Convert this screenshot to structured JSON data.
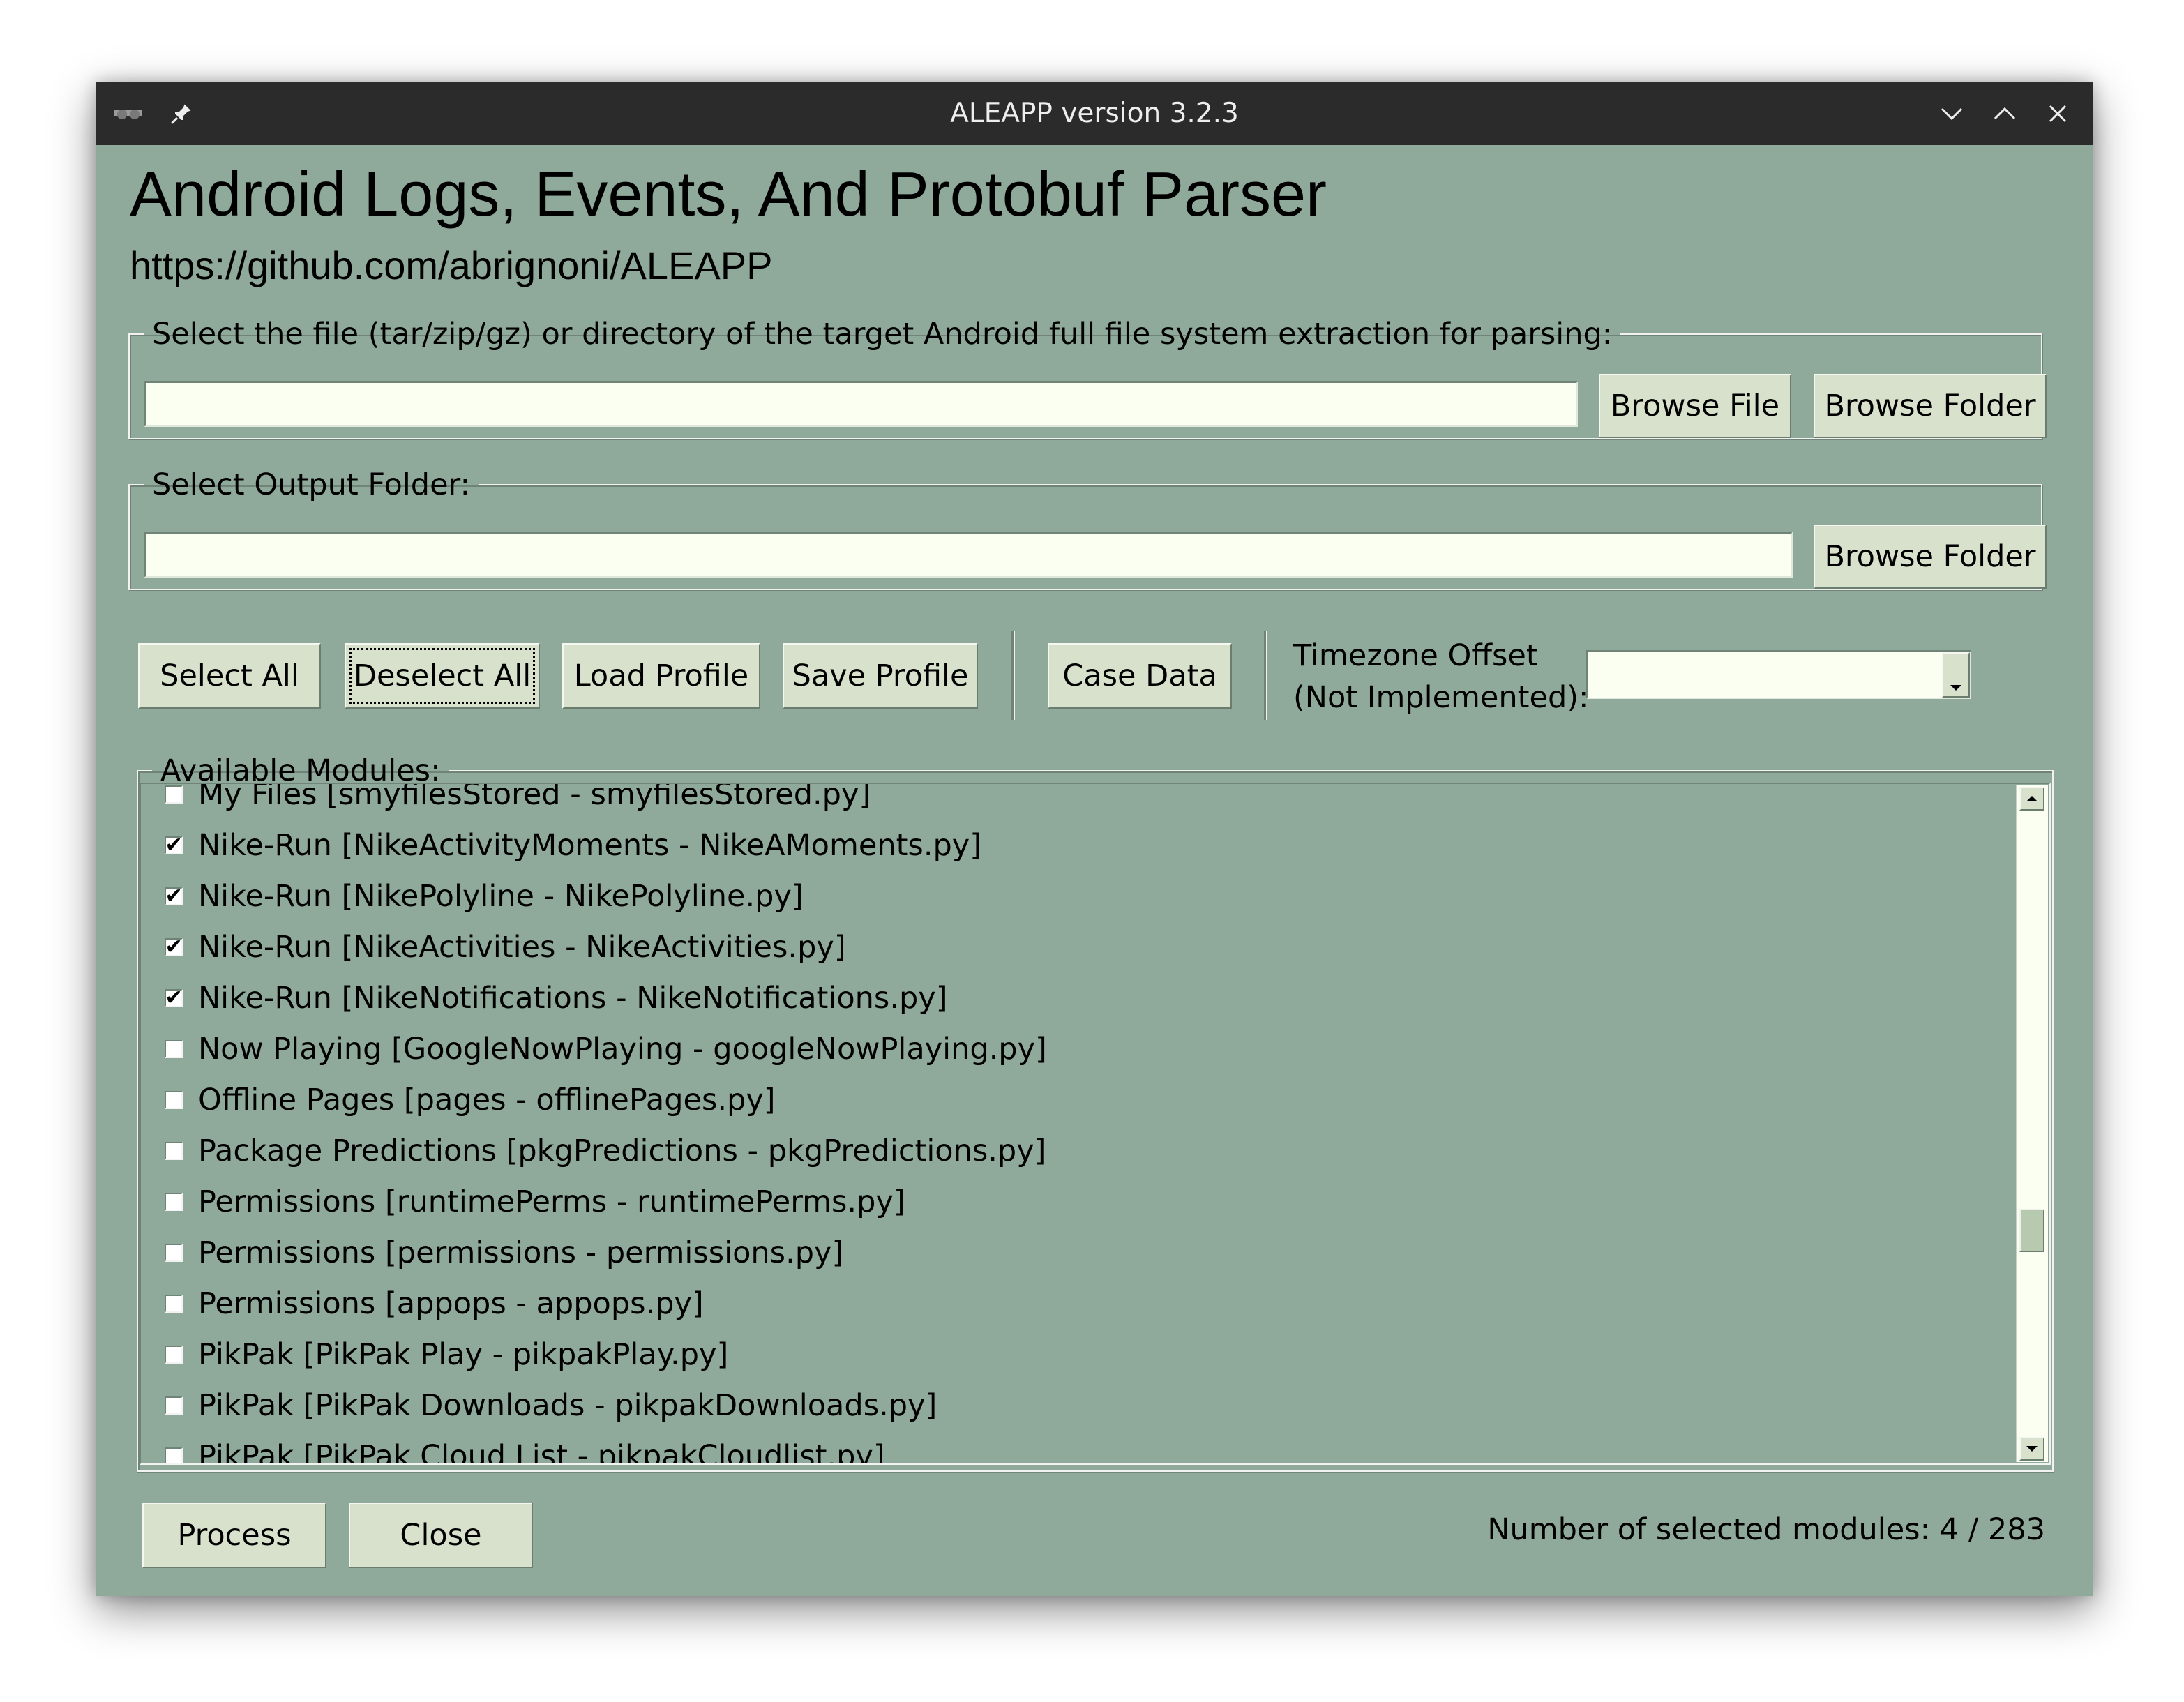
{
  "window": {
    "title": "ALEAPP version 3.2.3",
    "icons": [
      "app-icon",
      "pin-icon",
      "minimize-icon",
      "maximize-icon",
      "close-icon"
    ]
  },
  "header": {
    "title": "Android Logs, Events, And Protobuf Parser",
    "url": "https://github.com/abrignoni/ALEAPP"
  },
  "input_section": {
    "legend": "Select the file (tar/zip/gz) or directory of the target Android full file system extraction for parsing:",
    "value": "",
    "browse_file_label": "Browse File",
    "browse_folder_label": "Browse Folder"
  },
  "output_section": {
    "legend": "Select Output Folder:",
    "value": "",
    "browse_folder_label": "Browse Folder"
  },
  "toolbar": {
    "select_all": "Select All",
    "deselect_all": "Deselect All",
    "load_profile": "Load Profile",
    "save_profile": "Save Profile",
    "case_data": "Case Data",
    "timezone_label_line1": "Timezone Offset",
    "timezone_label_line2": "(Not Implemented):",
    "timezone_value": ""
  },
  "modules": {
    "legend": "Available Modules:",
    "items": [
      {
        "label": "My Files [smyfilesStored - smyfilesStored.py]",
        "checked": false
      },
      {
        "label": "Nike-Run [NikeActivityMoments - NikeAMoments.py]",
        "checked": true
      },
      {
        "label": "Nike-Run [NikePolyline - NikePolyline.py]",
        "checked": true
      },
      {
        "label": "Nike-Run [NikeActivities - NikeActivities.py]",
        "checked": true
      },
      {
        "label": "Nike-Run [NikeNotifications - NikeNotifications.py]",
        "checked": true
      },
      {
        "label": "Now Playing [GoogleNowPlaying - googleNowPlaying.py]",
        "checked": false
      },
      {
        "label": "Offline Pages [pages - offlinePages.py]",
        "checked": false
      },
      {
        "label": "Package Predictions [pkgPredictions - pkgPredictions.py]",
        "checked": false
      },
      {
        "label": "Permissions [runtimePerms - runtimePerms.py]",
        "checked": false
      },
      {
        "label": "Permissions [permissions - permissions.py]",
        "checked": false
      },
      {
        "label": "Permissions [appops - appops.py]",
        "checked": false
      },
      {
        "label": "PikPak [PikPak Play - pikpakPlay.py]",
        "checked": false
      },
      {
        "label": "PikPak [PikPak Downloads - pikpakDownloads.py]",
        "checked": false
      },
      {
        "label": "PikPak [PikPak Cloud List - pikpakCloudlist.py]",
        "checked": false
      }
    ],
    "scroll_position": 0.68
  },
  "footer": {
    "process": "Process",
    "close": "Close",
    "status": "Number of selected modules: 4 / 283"
  }
}
